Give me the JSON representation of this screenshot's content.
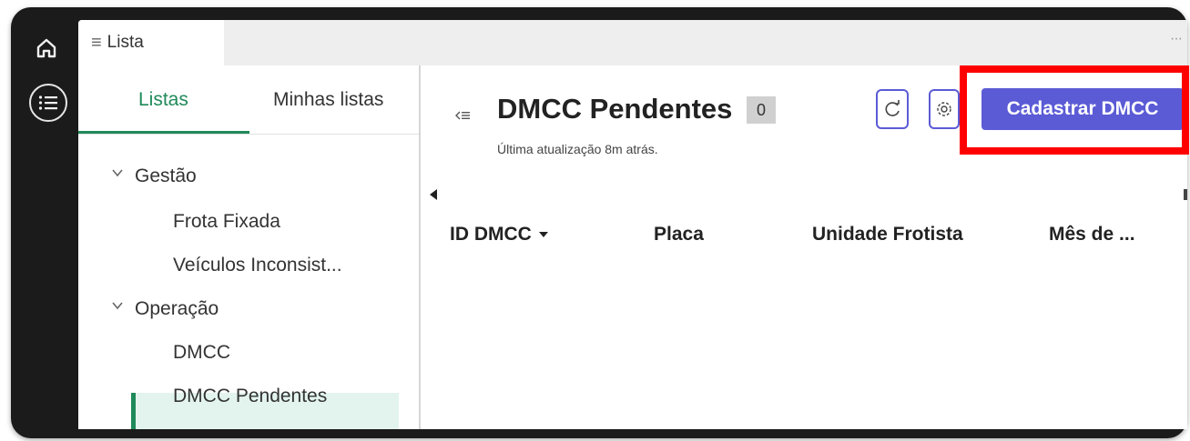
{
  "tabbar": {
    "tab_label": "Lista",
    "more_label": "···"
  },
  "sidebar": {
    "tabs": [
      {
        "label": "Listas",
        "active": true
      },
      {
        "label": "Minhas listas",
        "active": false
      }
    ],
    "tree": [
      {
        "label": "Gestão",
        "type": "group",
        "expanded": true
      },
      {
        "label": "Frota Fixada",
        "type": "item"
      },
      {
        "label": "Veículos Inconsist...",
        "type": "item"
      },
      {
        "label": "Operação",
        "type": "group",
        "expanded": true
      },
      {
        "label": "DMCC",
        "type": "item"
      },
      {
        "label": "DMCC Pendentes",
        "type": "item",
        "selected": true
      }
    ]
  },
  "main": {
    "title": "DMCC Pendentes",
    "count": "0",
    "last_update": "Última atualização 8m atrás.",
    "primary_button": "Cadastrar DMCC",
    "columns": [
      {
        "label": "ID DMCC",
        "sorted": true
      },
      {
        "label": "Placa"
      },
      {
        "label": "Unidade Frotista"
      },
      {
        "label": "Mês de ..."
      }
    ]
  },
  "colors": {
    "accent_green": "#1f8a5a",
    "primary_purple": "#5b5bd6",
    "highlight_red": "#ff0000",
    "selected_bg": "#e3f4ef"
  },
  "icons": {
    "rail": [
      "home-icon",
      "menu-list-icon"
    ],
    "toolbar": [
      "refresh-icon",
      "settings-icon"
    ],
    "collapse": "collapse-sidebar-icon"
  }
}
